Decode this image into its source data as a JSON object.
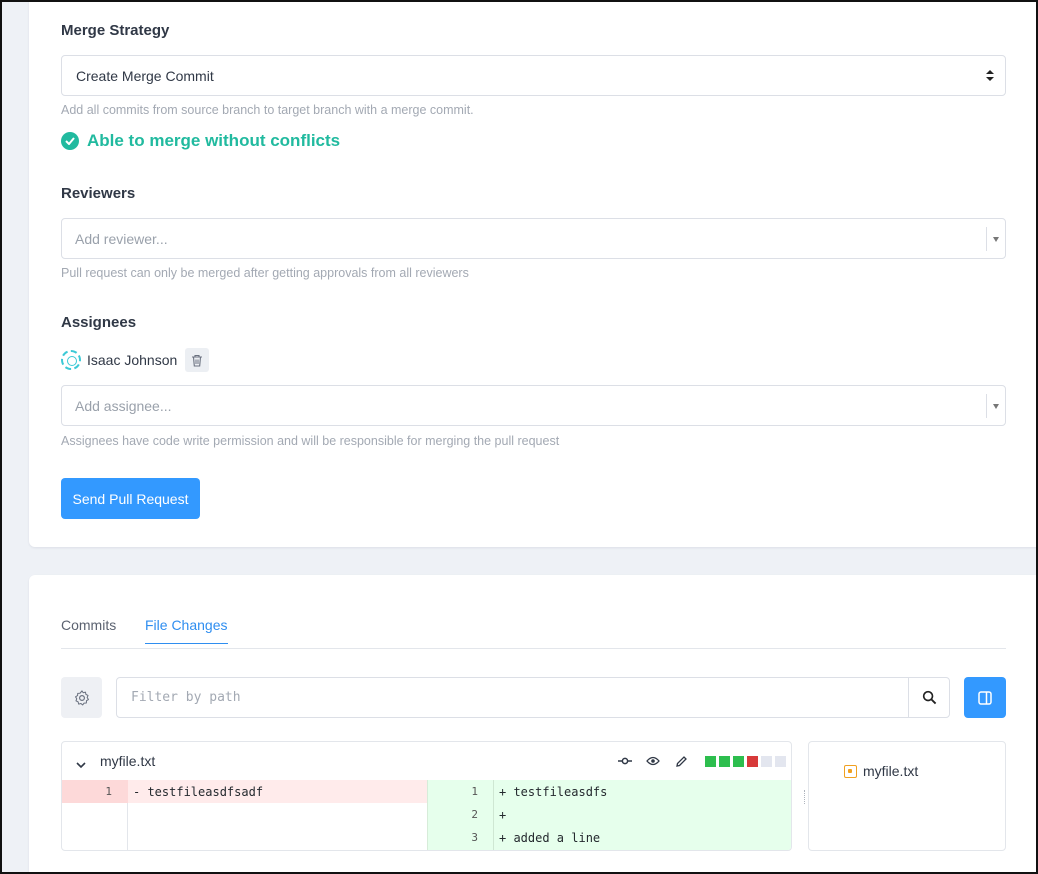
{
  "merge_strategy": {
    "label": "Merge Strategy",
    "selected": "Create Merge Commit",
    "help": "Add all commits from source branch to target branch with a merge commit.",
    "status": "Able to merge without conflicts"
  },
  "reviewers": {
    "label": "Reviewers",
    "placeholder": "Add reviewer...",
    "help": "Pull request can only be merged after getting approvals from all reviewers"
  },
  "assignees": {
    "label": "Assignees",
    "list": [
      {
        "name": "Isaac Johnson"
      }
    ],
    "placeholder": "Add assignee...",
    "help": "Assignees have code write permission and will be responsible for merging the pull request"
  },
  "submit_label": "Send Pull Request",
  "tabs": [
    {
      "label": "Commits",
      "active": false
    },
    {
      "label": "File Changes",
      "active": true
    }
  ],
  "filter": {
    "placeholder": "Filter by path"
  },
  "diff": {
    "filename": "myfile.txt",
    "stat_colors": [
      "#2dbe4e",
      "#2dbe4e",
      "#2dbe4e",
      "#d73a3a",
      "#e3e6ef",
      "#e3e6ef"
    ],
    "left_lines": [
      {
        "num": "1",
        "text": "- testfileasdfsadf"
      }
    ],
    "right_lines": [
      {
        "num": "1",
        "text": "+ testfileasdfs"
      },
      {
        "num": "2",
        "text": "+"
      },
      {
        "num": "3",
        "text": "+ added a line"
      }
    ]
  },
  "file_tree": {
    "items": [
      {
        "name": "myfile.txt"
      }
    ]
  },
  "colors": {
    "accent": "#3399ff",
    "success": "#21ba9f"
  }
}
